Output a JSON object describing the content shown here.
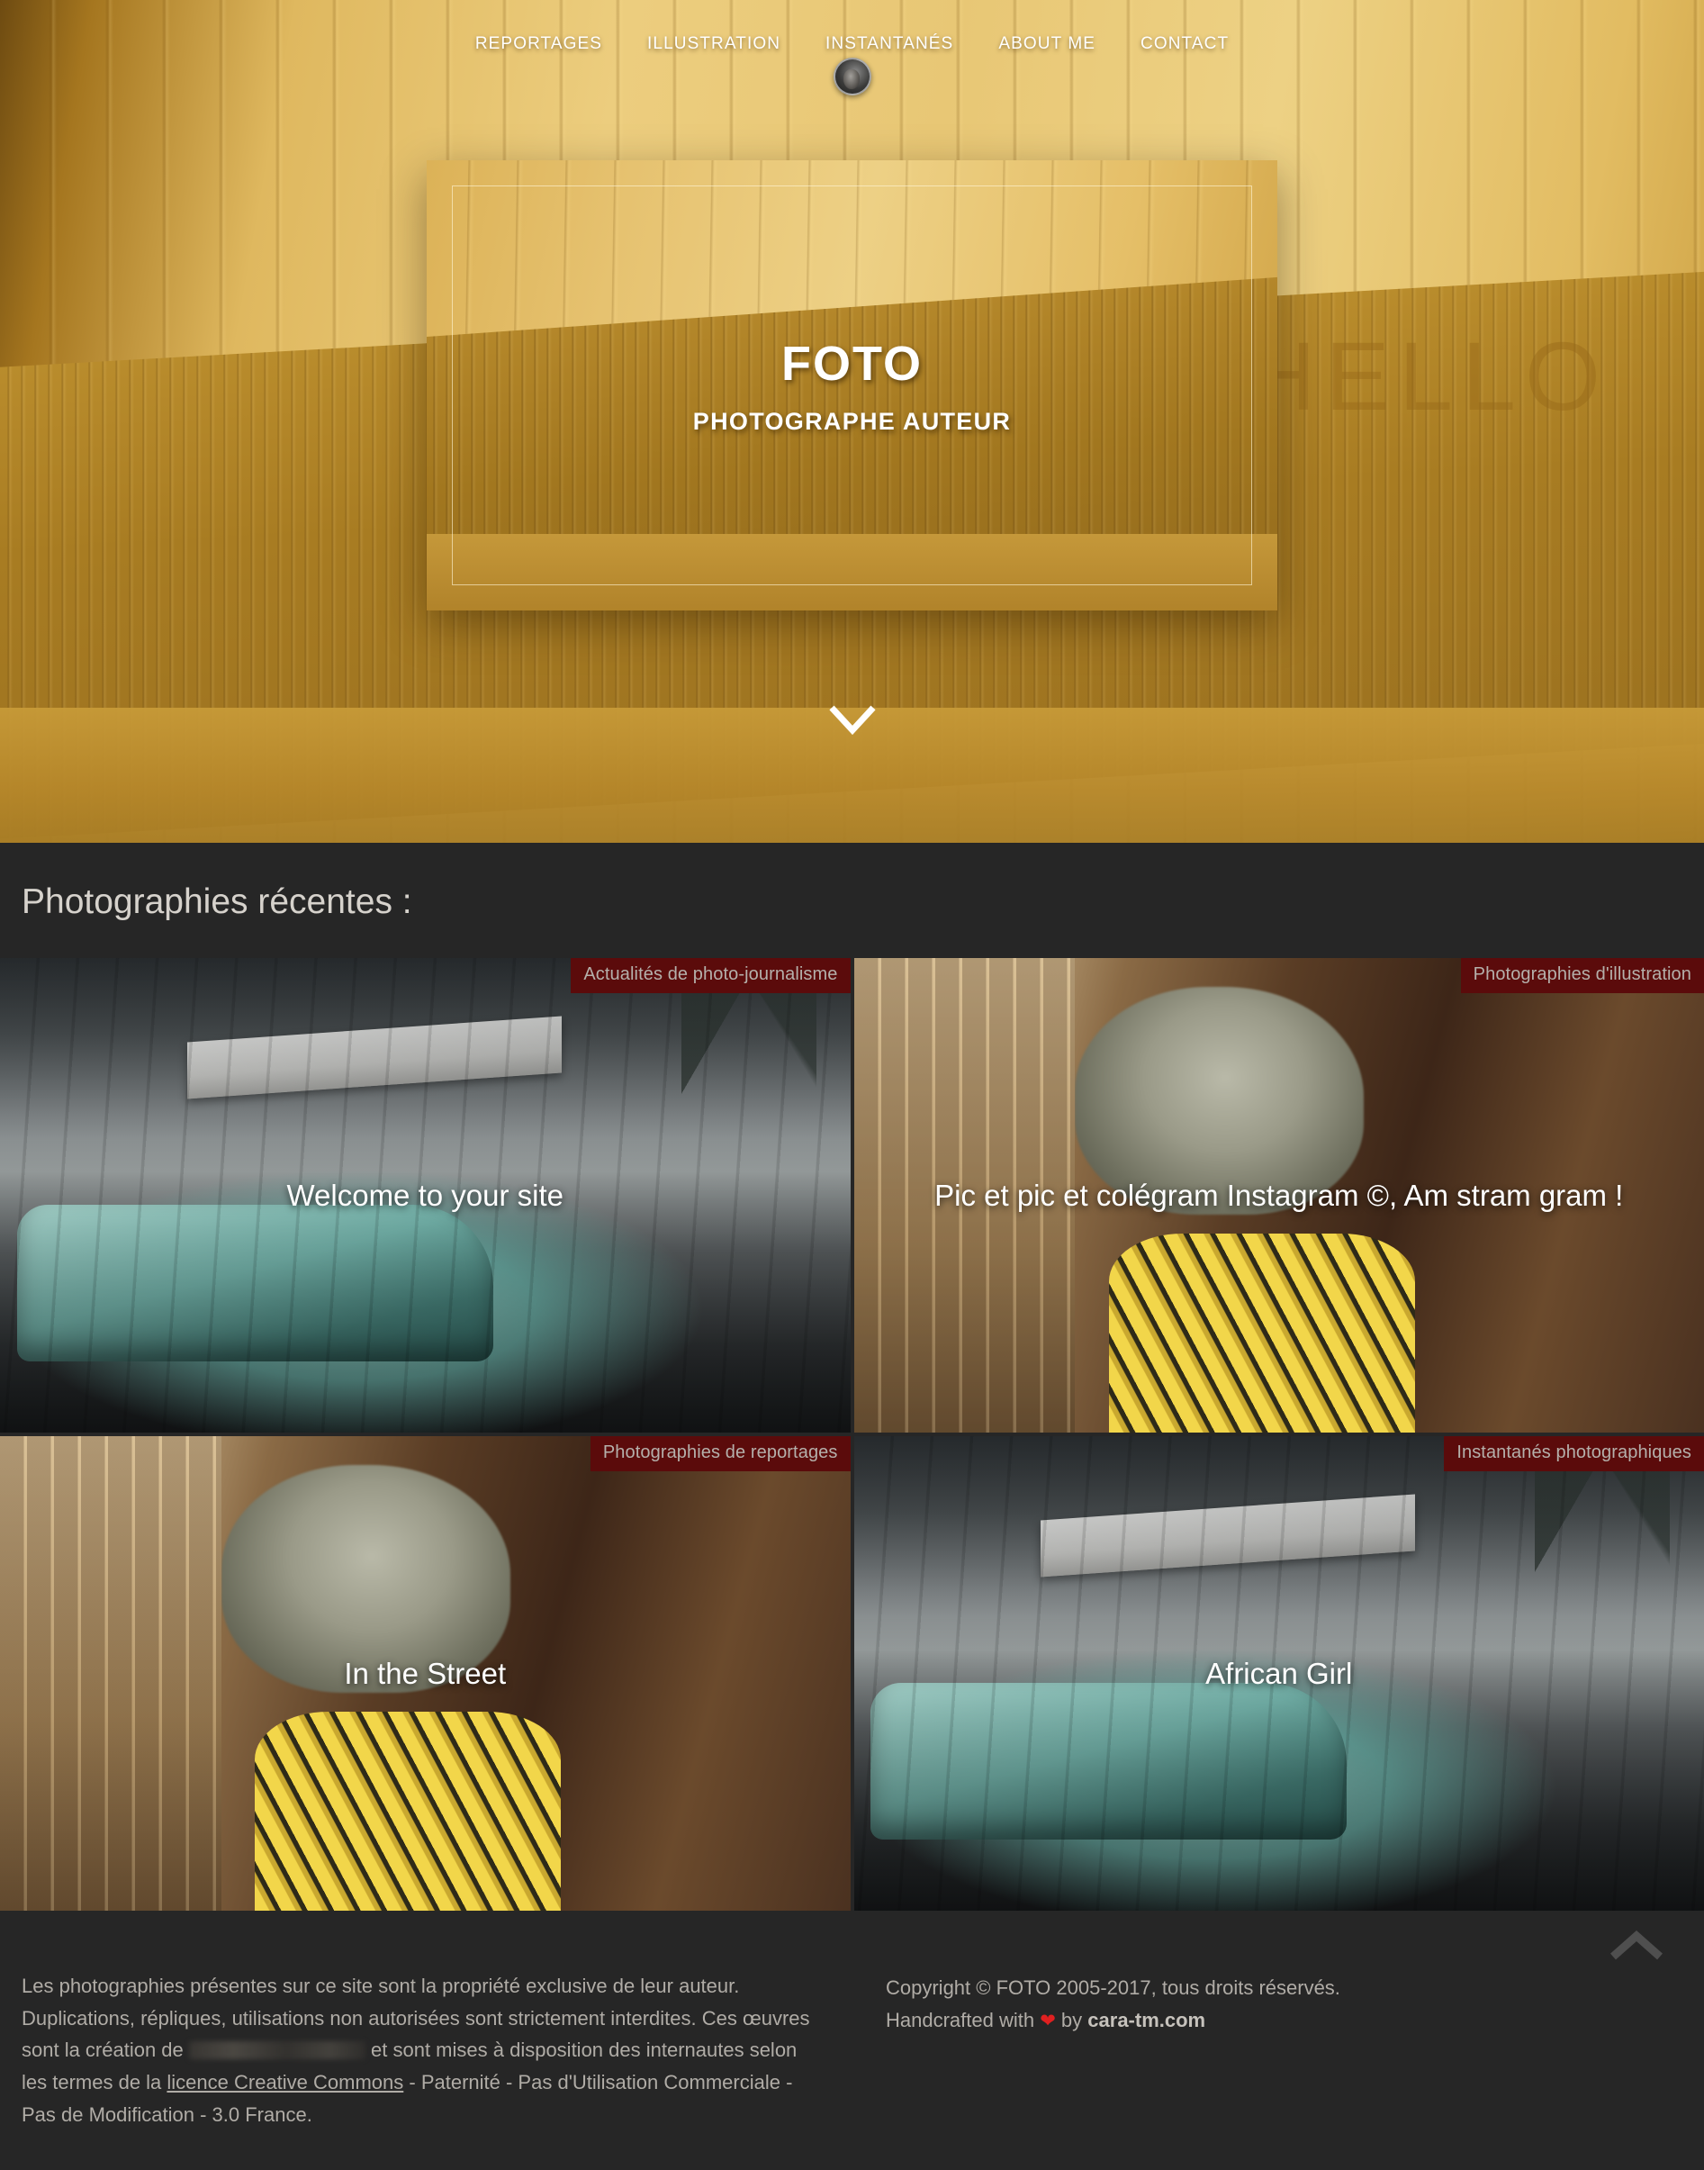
{
  "nav": {
    "items": [
      {
        "label": "REPORTAGES"
      },
      {
        "label": "ILLUSTRATION"
      },
      {
        "label": "INSTANTANÉS"
      },
      {
        "label": "ABOUT ME"
      },
      {
        "label": "CONTACT"
      }
    ]
  },
  "hero": {
    "title": "FOTO",
    "subtitle": "PHOTOGRAPHE AUTEUR",
    "wall_text_large": "HELLO",
    "wall_text_small": "HELLO"
  },
  "section": {
    "heading": "Photographies récentes :"
  },
  "gallery": {
    "tiles": [
      {
        "category": "Actualités de photo-journalisme",
        "title": "Welcome to your site"
      },
      {
        "category": "Photographies d'illustration",
        "title": "Pic et pic et colégram Instagram ©, Am stram gram !"
      },
      {
        "category": "Photographies de reportages",
        "title": "In the Street"
      },
      {
        "category": "Instantanés photographiques",
        "title": "African Girl"
      }
    ]
  },
  "footer": {
    "legal_part1": "Les photographies présentes sur ce site sont la propriété exclusive de leur auteur. Duplications, répliques, utilisations non autorisées sont strictement interdites. Ces œuvres sont la création de ",
    "legal_part2": " et sont mises à disposition des internautes selon les termes de la ",
    "license_link": "licence Creative Commons",
    "legal_part3": " - Paternité - Pas d'Utilisation Commerciale - Pas de Modification - 3.0 France.",
    "copyright": "Copyright © FOTO 2005-2017, tous droits réservés.",
    "handcrafted_prefix": "Handcrafted with ",
    "heart": "❤",
    "handcrafted_mid": " by ",
    "brand": "cara-tm.com"
  },
  "colors": {
    "page_bg": "#262626",
    "hero_gold": "#e8c775",
    "category_badge": "#5b0b0b",
    "heart_red": "#e02020",
    "footer_text": "#b0aca6"
  }
}
